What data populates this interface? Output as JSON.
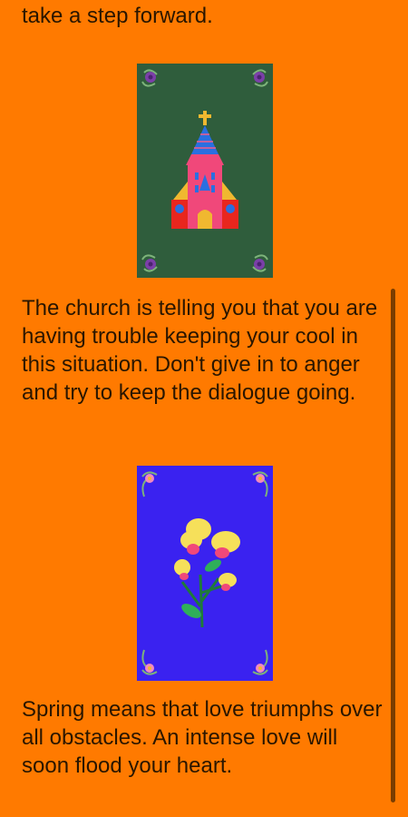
{
  "texts": {
    "intro_tail": "take a step forward.",
    "church_meaning": "The church is telling you that you are having trouble keeping your cool in this situation. Don't give in to anger and try to keep the dialogue going.",
    "spring_meaning": "Spring means that love triumphs over all obstacles. An intense love will soon flood your heart."
  },
  "cards": [
    {
      "icon": "church-card-icon",
      "background": "#2F5D3C"
    },
    {
      "icon": "spring-flower-card-icon",
      "background": "#3A22F0"
    }
  ],
  "colors": {
    "page_background": "#FF7A00",
    "text": "#2a1600",
    "scrollbar": "#7A3D00"
  }
}
